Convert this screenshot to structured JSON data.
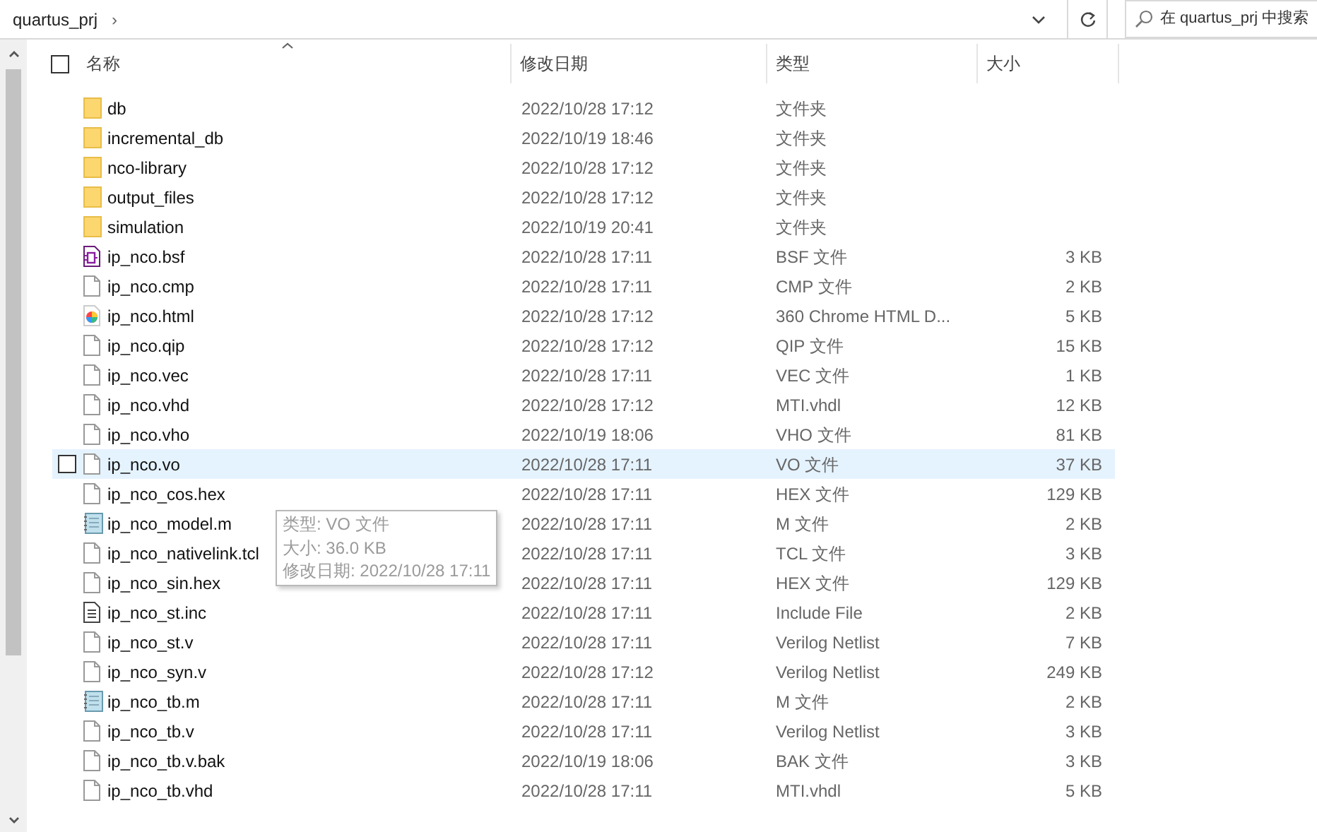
{
  "address_bar": {
    "path": "quartus_prj",
    "separator": "›"
  },
  "search": {
    "placeholder": "在 quartus_prj 中搜索"
  },
  "select_all": {
    "checked": false
  },
  "columns": [
    {
      "label": "名称",
      "sorted": true
    },
    {
      "label": "修改日期",
      "sorted": false
    },
    {
      "label": "类型",
      "sorted": false
    },
    {
      "label": "大小",
      "sorted": false
    }
  ],
  "rows": [
    {
      "name": "db",
      "date": "2022/10/28 17:12",
      "type": "文件夹",
      "kind": "folder",
      "selected": false
    },
    {
      "name": "incremental_db",
      "date": "2022/10/19 18:46",
      "type": "文件夹",
      "kind": "folder",
      "selected": false
    },
    {
      "name": "nco-library",
      "date": "2022/10/28 17:12",
      "type": "文件夹",
      "kind": "folder",
      "selected": false
    },
    {
      "name": "output_files",
      "date": "2022/10/28 17:12",
      "type": "文件夹",
      "kind": "folder",
      "selected": false
    },
    {
      "name": "simulation",
      "date": "2022/10/19 20:41",
      "type": "文件夹",
      "kind": "folder",
      "selected": false
    },
    {
      "name": "ip_nco.bsf",
      "date": "2022/10/28 17:11",
      "type": "BSF 文件",
      "size": "3 KB",
      "kind": "symbol",
      "selected": false
    },
    {
      "name": "ip_nco.cmp",
      "date": "2022/10/28 17:11",
      "type": "CMP 文件",
      "size": "2 KB",
      "kind": "file",
      "selected": false
    },
    {
      "name": "ip_nco.html",
      "date": "2022/10/28 17:12",
      "type": "360 Chrome HTML D...",
      "size": "5 KB",
      "kind": "web",
      "selected": false
    },
    {
      "name": "ip_nco.qip",
      "date": "2022/10/28 17:12",
      "type": "QIP 文件",
      "size": "15 KB",
      "kind": "file",
      "selected": false
    },
    {
      "name": "ip_nco.vec",
      "date": "2022/10/28 17:11",
      "type": "VEC 文件",
      "size": "1 KB",
      "kind": "file",
      "selected": false
    },
    {
      "name": "ip_nco.vhd",
      "date": "2022/10/28 17:12",
      "type": "MTI.vhdl",
      "size": "12 KB",
      "kind": "file",
      "selected": false
    },
    {
      "name": "ip_nco.vho",
      "date": "2022/10/19 18:06",
      "type": "VHO 文件",
      "size": "81 KB",
      "kind": "file",
      "selected": false
    },
    {
      "name": "ip_nco.vo",
      "date": "2022/10/28 17:11",
      "type": "VO 文件",
      "size": "37 KB",
      "kind": "file",
      "selected": true
    },
    {
      "name": "ip_nco_cos.hex",
      "date": "2022/10/28 17:11",
      "type": "HEX 文件",
      "size": "129 KB",
      "kind": "file",
      "selected": false
    },
    {
      "name": "ip_nco_model.m",
      "date": "2022/10/28 17:11",
      "type": "M 文件",
      "size": "2 KB",
      "kind": "notebook",
      "selected": false
    },
    {
      "name": "ip_nco_nativelink.tcl",
      "date": "2022/10/28 17:11",
      "type": "TCL 文件",
      "size": "3 KB",
      "kind": "file",
      "selected": false
    },
    {
      "name": "ip_nco_sin.hex",
      "date": "2022/10/28 17:11",
      "type": "HEX 文件",
      "size": "129 KB",
      "kind": "file",
      "selected": false
    },
    {
      "name": "ip_nco_st.inc",
      "date": "2022/10/28 17:11",
      "type": "Include File",
      "size": "2 KB",
      "kind": "text",
      "selected": false
    },
    {
      "name": "ip_nco_st.v",
      "date": "2022/10/28 17:11",
      "type": "Verilog Netlist",
      "size": "7 KB",
      "kind": "file",
      "selected": false
    },
    {
      "name": "ip_nco_syn.v",
      "date": "2022/10/28 17:12",
      "type": "Verilog Netlist",
      "size": "249 KB",
      "kind": "file",
      "selected": false
    },
    {
      "name": "ip_nco_tb.m",
      "date": "2022/10/28 17:11",
      "type": "M 文件",
      "size": "2 KB",
      "kind": "notebook",
      "selected": false
    },
    {
      "name": "ip_nco_tb.v",
      "date": "2022/10/28 17:11",
      "type": "Verilog Netlist",
      "size": "3 KB",
      "kind": "file",
      "selected": false
    },
    {
      "name": "ip_nco_tb.v.bak",
      "date": "2022/10/19 18:06",
      "type": "BAK 文件",
      "size": "3 KB",
      "kind": "file",
      "selected": false
    },
    {
      "name": "ip_nco_tb.vhd",
      "date": "2022/10/28 17:11",
      "type": "MTI.vhdl",
      "size": "5 KB",
      "kind": "file",
      "selected": false
    }
  ],
  "tooltip": {
    "lines": [
      "类型: VO 文件",
      "大小: 36.0 KB",
      "修改日期: 2022/10/28 17:11"
    ]
  }
}
